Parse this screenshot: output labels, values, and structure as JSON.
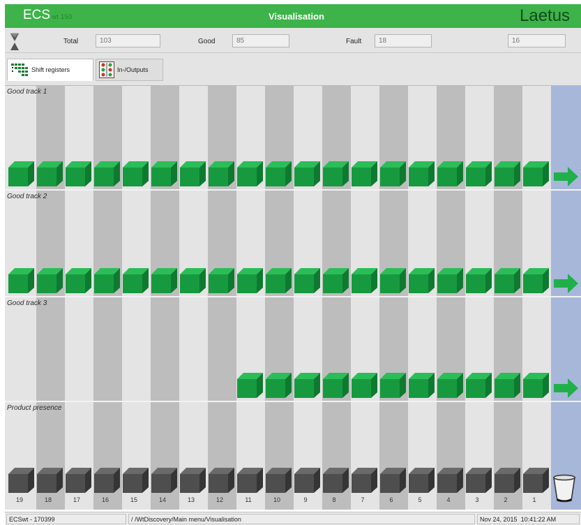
{
  "header": {
    "app_title": "ECS",
    "app_subtitle": "wt 150",
    "window_title": "Visualisation",
    "brand": "Laetus"
  },
  "counters": {
    "total_label": "Total",
    "total_value": "103",
    "good_label": "Good",
    "good_value": "85",
    "fault_label": "Fault",
    "fault_value": "18",
    "extra_value": "16"
  },
  "tabs": [
    {
      "label": "Shift registers",
      "icon": "shift-registers-icon",
      "active": true
    },
    {
      "label": "In-/Outputs",
      "icon": "io-lights-icon",
      "active": false
    }
  ],
  "visualisation": {
    "tracks": [
      {
        "label": "Good track 1",
        "filled_positions": 19
      },
      {
        "label": "Good track 2",
        "filled_positions": 19
      },
      {
        "label": "Good track 3",
        "filled_positions": 11
      }
    ],
    "presence_label": "Product presence",
    "positions": [
      "19",
      "18",
      "17",
      "16",
      "15",
      "14",
      "13",
      "12",
      "11",
      "10",
      "9",
      "8",
      "7",
      "6",
      "5",
      "4",
      "3",
      "2",
      "1"
    ],
    "colors": {
      "good_product": "#1ea84a",
      "presence_product": "#555555",
      "exit_lane": "#a7b7da",
      "header": "#3db34a"
    }
  },
  "statusbar": {
    "device": "ECSwt - 170399",
    "path": "/ /WtDiscovery/Main menu/Visualisation",
    "date": "Nov 24, 2015",
    "time": "10:41:22 AM"
  }
}
